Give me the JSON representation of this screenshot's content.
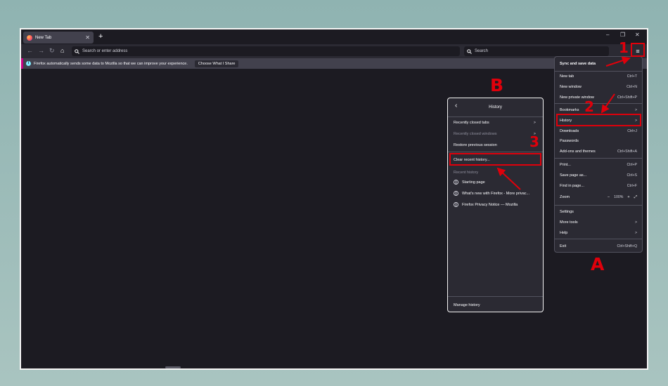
{
  "tab": {
    "title": "New Tab",
    "close": "✕",
    "new_tab": "+"
  },
  "window_controls": {
    "minimize": "–",
    "restore": "❐",
    "close": "✕"
  },
  "navbar": {
    "url_placeholder": "Search or enter address",
    "search_placeholder": "Search",
    "menu_icon": "≡"
  },
  "infobar": {
    "message": "Firefox automatically sends some data to Mozilla so that we can improve your experience.",
    "button": "Choose What I Share"
  },
  "app_menu": {
    "sync": "Sync and save data",
    "items": [
      {
        "label": "New tab",
        "shortcut": "Ctrl+T"
      },
      {
        "label": "New window",
        "shortcut": "Ctrl+N"
      },
      {
        "label": "New private window",
        "shortcut": "Ctrl+Shift+P"
      },
      {
        "label": "Bookmarks",
        "shortcut": ">"
      },
      {
        "label": "History",
        "shortcut": ">"
      },
      {
        "label": "Downloads",
        "shortcut": "Ctrl+J"
      },
      {
        "label": "Passwords",
        "shortcut": ""
      },
      {
        "label": "Add-ons and themes",
        "shortcut": "Ctrl+Shift+A"
      },
      {
        "label": "Print...",
        "shortcut": "Ctrl+P"
      },
      {
        "label": "Save page as...",
        "shortcut": "Ctrl+S"
      },
      {
        "label": "Find in page...",
        "shortcut": "Ctrl+F"
      },
      {
        "label": "Settings",
        "shortcut": ""
      },
      {
        "label": "More tools",
        "shortcut": ">"
      },
      {
        "label": "Help",
        "shortcut": ">"
      },
      {
        "label": "Exit",
        "shortcut": "Ctrl+Shift+Q"
      }
    ],
    "zoom": {
      "label": "Zoom",
      "minus": "−",
      "value": "100%",
      "plus": "+",
      "fullscreen": "⤢"
    }
  },
  "history_panel": {
    "title": "History",
    "back": "‹",
    "items": [
      {
        "label": "Recently closed tabs",
        "chevron": ">"
      },
      {
        "label": "Recently closed windows",
        "chevron": ">"
      },
      {
        "label": "Restore previous session",
        "chevron": ""
      },
      {
        "label": "Clear recent history...",
        "chevron": ""
      }
    ],
    "section_label": "Recent history",
    "recent": [
      "Starting page",
      "What's new with Firefox - More privac...",
      "Firefox Privacy Notice — Mozilla"
    ],
    "manage": "Manage history"
  },
  "annotations": {
    "step1": "1",
    "step2": "2",
    "step3": "3",
    "labelA": "A",
    "labelB": "B"
  },
  "colors": {
    "highlight": "#e0000b",
    "bg": "#1c1b22",
    "panel": "#2b2a33"
  }
}
